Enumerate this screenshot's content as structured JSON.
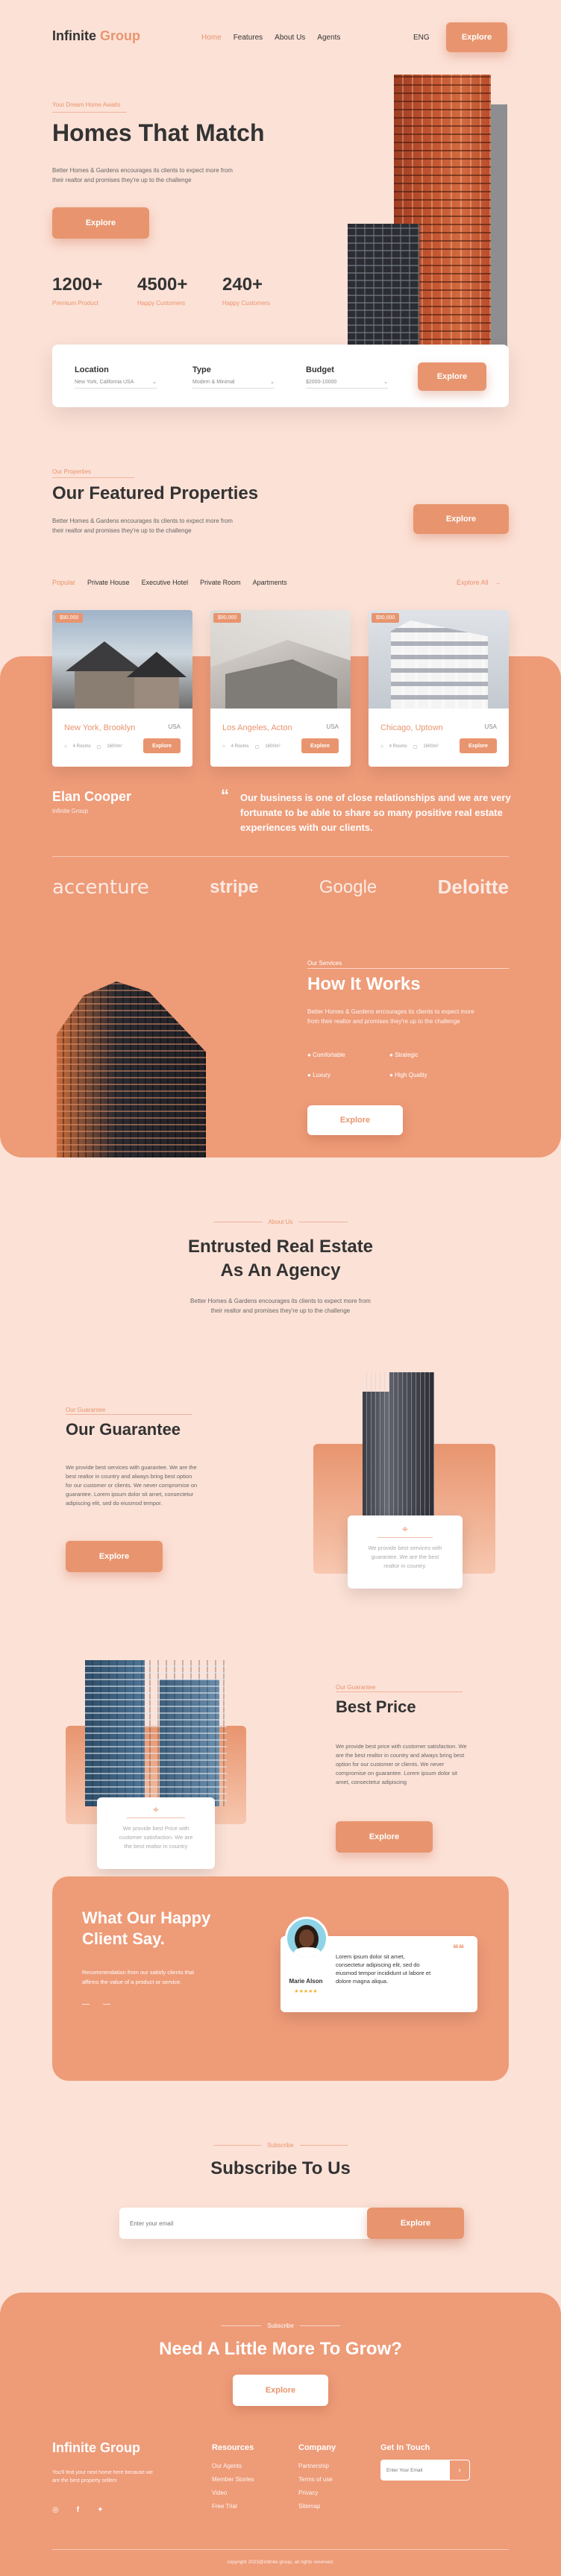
{
  "nav": {
    "brand_a": "Infinite",
    "brand_b": "Group",
    "links": [
      "Home",
      "Features",
      "About Us",
      "Agents"
    ],
    "lang": "ENG",
    "cta": "Explore"
  },
  "hero": {
    "eyebrow": "Your Dream Home Awaits",
    "title": "Homes That Match",
    "desc1": "Better Homes & Gardens encourages its clients to expect more from",
    "desc2": "their realtor and promises they're up to the challenge",
    "cta": "Explore",
    "stats": [
      {
        "value": "1200+",
        "label": "Premium Product"
      },
      {
        "value": "4500+",
        "label": "Happy Customers"
      },
      {
        "value": "240+",
        "label": "Happy Customers"
      }
    ]
  },
  "search": {
    "location_label": "Location",
    "location_value": "New York, California USA",
    "type_label": "Type",
    "type_value": "Modern & Minimal",
    "budget_label": "Budget",
    "budget_value": "$2000-10000",
    "cta": "Explore"
  },
  "featured": {
    "eyebrow": "Our Properties",
    "title": "Our Featured Properties",
    "desc1": "Better Homes & Gardens encourages its clients to expect more from",
    "desc2": "their realtor and promises they're up to the challenge",
    "cta": "Explore",
    "tabs": [
      "Popular",
      "Private House",
      "Executive Hotel",
      "Private Room",
      "Apartments"
    ],
    "explore_all": "Explore All",
    "cards": [
      {
        "price": "$90,000",
        "title": "New York, Brooklyn",
        "country": "USA",
        "beds": "4 Rooms",
        "area": "1600m²",
        "cta": "Explore"
      },
      {
        "price": "$90,000",
        "title": "Los Angeles, Acton",
        "country": "USA",
        "beds": "4 Rooms",
        "area": "1600m²",
        "cta": "Explore"
      },
      {
        "price": "$90,000",
        "title": "Chicago, Uptown",
        "country": "USA",
        "beds": "4 Rooms",
        "area": "1600m²",
        "cta": "Explore"
      }
    ]
  },
  "testimonial_strip": {
    "name": "Elan Cooper",
    "company": "Infinite Group",
    "quote1": "Our business is one of close relationships and we are very",
    "quote2": "fortunate to be able to share so many positive real estate",
    "quote3": "experiences with our clients."
  },
  "logos": [
    "accenture",
    "stripe",
    "Google",
    "Deloitte"
  ],
  "how": {
    "eyebrow": "Our Services",
    "title": "How It Works",
    "desc1": "Better Homes & Gardens encourages its clients to expect more",
    "desc2": "from their realtor and promises they're up to the challenge",
    "features": [
      "Comfortable",
      "Strategic",
      "Luxury",
      "High Quality"
    ],
    "cta": "Explore"
  },
  "agency": {
    "eyebrow": "About Us",
    "title1": "Entrusted Real Estate",
    "title2": "As An Agency",
    "desc1": "Better Homes & Gardens encourages its clients to expect more from",
    "desc2": "their realtor and promises they're up to the challenge"
  },
  "guarantee": {
    "eyebrow": "Our Guarantee",
    "title": "Our Guarantee",
    "body": [
      "We provide best services with guarantee. We are the",
      "best realtor in country and always bring best option",
      "for our customer or clients. We never compromise on",
      "guarantee. Lorem ipsum dolor sit amet, consectetur",
      "adipiscing elit, sed do eiusmod tempor."
    ],
    "cta": "Explore",
    "card_text": [
      "We provide best services with",
      "guarantee. We are the best",
      "realtor in country."
    ]
  },
  "price": {
    "eyebrow": "Our Guarantee",
    "title": "Best Price",
    "body": [
      "We provide best price with customer satisfaction. We",
      "are the best realtor in country and always bring best",
      "option for our customer or clients. We never",
      "compromise on guarantee. Lorem ipsum dolor sit",
      "amet, consectetur adipiscing"
    ],
    "cta": "Explore",
    "card_text": [
      "We provide best Price with",
      "customer satisfaction. We are",
      "the best realtor in country"
    ]
  },
  "reviews": {
    "title1": "What Our Happy",
    "title2": "Client Say.",
    "desc1": "Recommendation from our satisfy clients that",
    "desc2": "affirms the value of a product or service.",
    "reviewer": "Marie Alson",
    "stars": "★★★★★",
    "review": [
      "Lorem ipsum dolor sit amet,",
      "consectetur adipiscing elit, sed do",
      "eiusmod tempor incididunt ut labore et",
      "dolore magna aliqua."
    ]
  },
  "subscribe": {
    "eyebrow": "Subscribe",
    "title": "Subscribe To Us",
    "placeholder": "Enter your email",
    "cta": "Explore"
  },
  "cta_band": {
    "eyebrow": "Subscribe",
    "title": "Need A Little More To Grow?",
    "cta": "Explore"
  },
  "footer": {
    "brand": "Infinite Group",
    "desc1": "You'll find your next home here because we",
    "desc2": "are the best property sellers",
    "social": [
      "instagram",
      "facebook",
      "twitter"
    ],
    "col1_title": "Resources",
    "col1": [
      "Our Agents",
      "Member Stories",
      "Video",
      "Free Trial"
    ],
    "col2_title": "Company",
    "col2": [
      "Partnership",
      "Terms of use",
      "Privacy",
      "Sitemap"
    ],
    "col3_title": "Get In Touch",
    "email_placeholder": "Enter Your Email",
    "copyright": "copyright 2023@infinite group, all rights reserved."
  },
  "colors": {
    "accent": "#E8956F",
    "background": "#FCE1D6",
    "band": "#EE9B78"
  }
}
